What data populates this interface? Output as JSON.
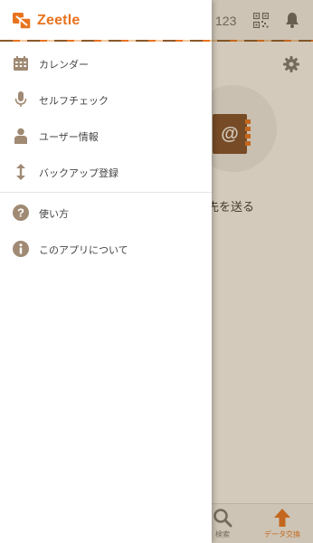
{
  "app": {
    "topbar": {
      "count": "123"
    },
    "send_label": "絡先を送る",
    "bottom_nav": {
      "search": "検索",
      "exchange": "データ交換"
    }
  },
  "drawer": {
    "logo": "Zeetle",
    "main_items": [
      {
        "label": "カレンダー",
        "icon": "calendar-icon"
      },
      {
        "label": "セルフチェック",
        "icon": "microphone-icon"
      },
      {
        "label": "ユーザー情報",
        "icon": "user-icon"
      },
      {
        "label": "バックアップ登録",
        "icon": "vertical-arrows-icon"
      }
    ],
    "sub_items": [
      {
        "label": "使い方",
        "icon": "help-icon"
      },
      {
        "label": "このアプリについて",
        "icon": "info-icon"
      }
    ]
  },
  "colors": {
    "accent": "#e8731f",
    "brown": "#8b5a2b",
    "icon": "#a08a74"
  }
}
